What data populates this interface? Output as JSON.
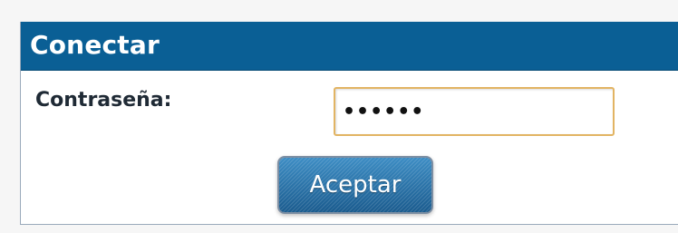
{
  "login_panel": {
    "title": "Conectar",
    "password_label": "Contraseña:",
    "password_value": "••••••",
    "submit_label": "Aceptar"
  },
  "colors": {
    "header_background": "#0a5f95",
    "input_border": "#e2b463",
    "button_background": "#2a72a8"
  }
}
